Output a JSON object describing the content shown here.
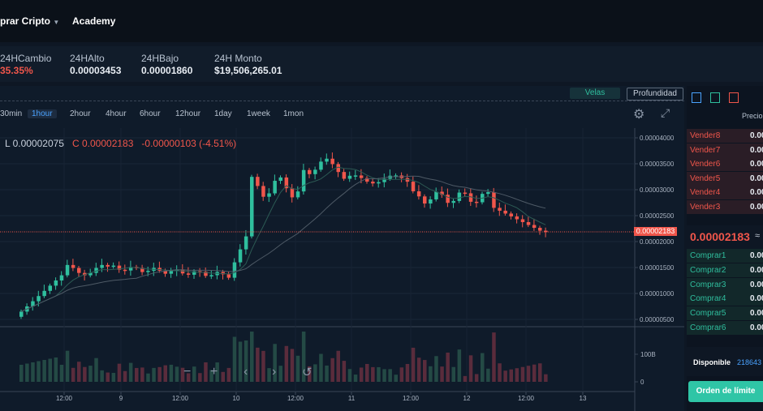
{
  "nav": {
    "buy_crypto": "prar Cripto",
    "academy": "Academy"
  },
  "stats": [
    {
      "label": "24HCambio",
      "value": "35.35%",
      "color": "#f0564b"
    },
    {
      "label": "24HAlto",
      "value": "0.00003453"
    },
    {
      "label": "24HBajo",
      "value": "0.00001860"
    },
    {
      "label": "24H Monto",
      "value": "$19,506,265.01"
    }
  ],
  "chart_tabs": {
    "velas": "Velas",
    "profundidad": "Profundidad"
  },
  "intervals": [
    "30min",
    "1hour",
    "2hour",
    "4hour",
    "6hour",
    "12hour",
    "1day",
    "1week",
    "1mon"
  ],
  "active_interval": "1hour",
  "ohlc": {
    "low": "L 0.00002075",
    "close": "C 0.00002183",
    "change": "-0.00000103 (-4.51%)"
  },
  "price_axis": [
    "0.00004000",
    "0.00003500",
    "0.00003000",
    "0.00002500",
    "0.00002000",
    "0.00001500",
    "0.00001000",
    "0.00000500"
  ],
  "current_price_tag": "0.00002183",
  "volume_axis": [
    "100B",
    "0"
  ],
  "time_axis": [
    "12:00",
    "9",
    "12:00",
    "10",
    "12:00",
    "11",
    "12:00",
    "12",
    "12:00",
    "13"
  ],
  "orderbook": {
    "header": "Precio",
    "sells": [
      {
        "label": "Vender8",
        "value": "0.00"
      },
      {
        "label": "Vender7",
        "value": "0.00"
      },
      {
        "label": "Vender6",
        "value": "0.00"
      },
      {
        "label": "Vender5",
        "value": "0.00"
      },
      {
        "label": "Vender4",
        "value": "0.00"
      },
      {
        "label": "Vender3",
        "value": "0.00"
      }
    ],
    "last_price": "0.00002183",
    "last_price_suffix": "≈",
    "buys": [
      {
        "label": "Comprar1",
        "value": "0.00"
      },
      {
        "label": "Comprar2",
        "value": "0.00"
      },
      {
        "label": "Comprar3",
        "value": "0.00"
      },
      {
        "label": "Comprar4",
        "value": "0.00"
      },
      {
        "label": "Comprar5",
        "value": "0.00"
      },
      {
        "label": "Comprar6",
        "value": "0.00"
      }
    ],
    "available_label": "Disponible",
    "available_value": "218643",
    "limit_order_button": "Orden de límite"
  },
  "colors": {
    "up": "#2fbf9e",
    "down": "#f0564b",
    "accent": "#4aa3ff"
  }
}
